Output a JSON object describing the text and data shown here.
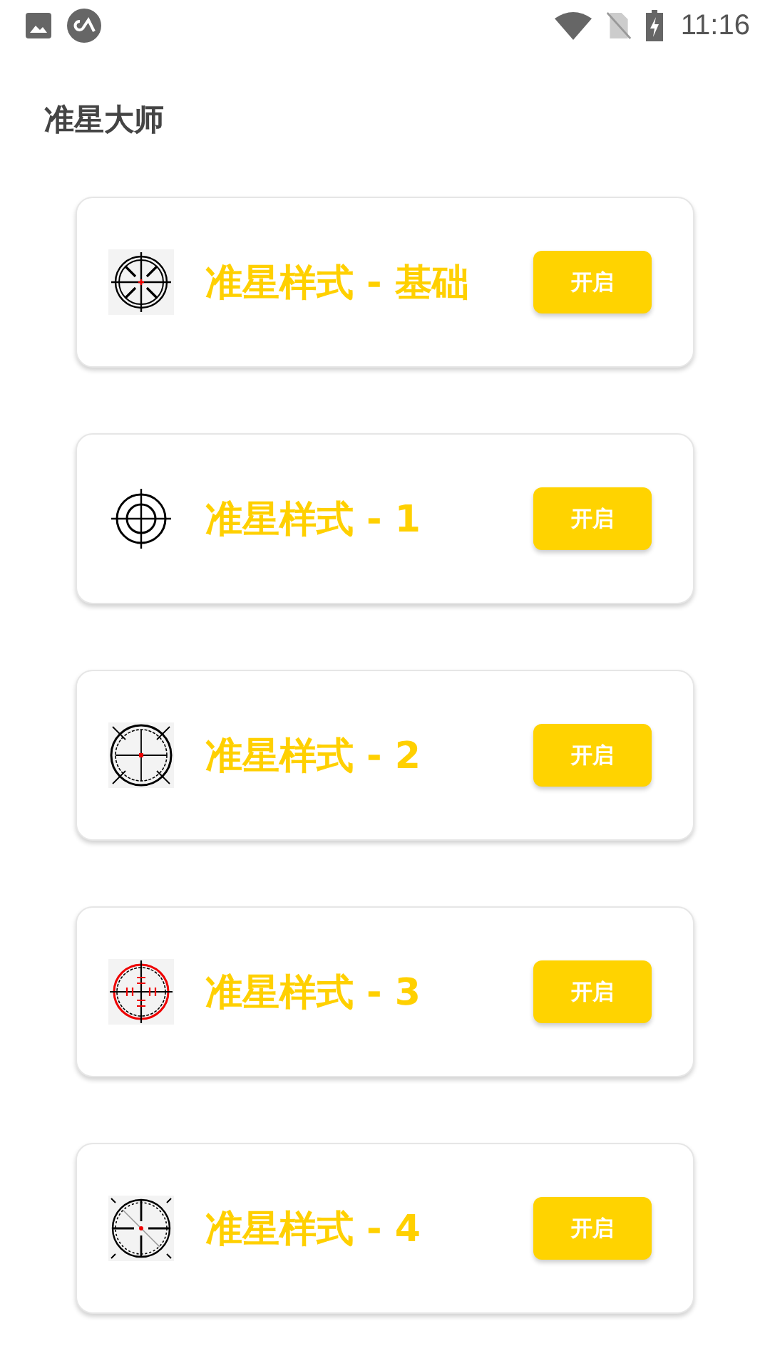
{
  "status_bar": {
    "time": "11:16"
  },
  "app_title": "准星大师",
  "styles": [
    {
      "kind": "basic",
      "title": "准星样式 - 基础",
      "button": "开启"
    },
    {
      "kind": "circle",
      "title": "准星样式 - 1",
      "button": "开启"
    },
    {
      "kind": "scope",
      "title": "准星样式 - 2",
      "button": "开启"
    },
    {
      "kind": "red",
      "title": "准星样式 - 3",
      "button": "开启"
    },
    {
      "kind": "dashed",
      "title": "准星样式 - 4",
      "button": "开启"
    }
  ]
}
